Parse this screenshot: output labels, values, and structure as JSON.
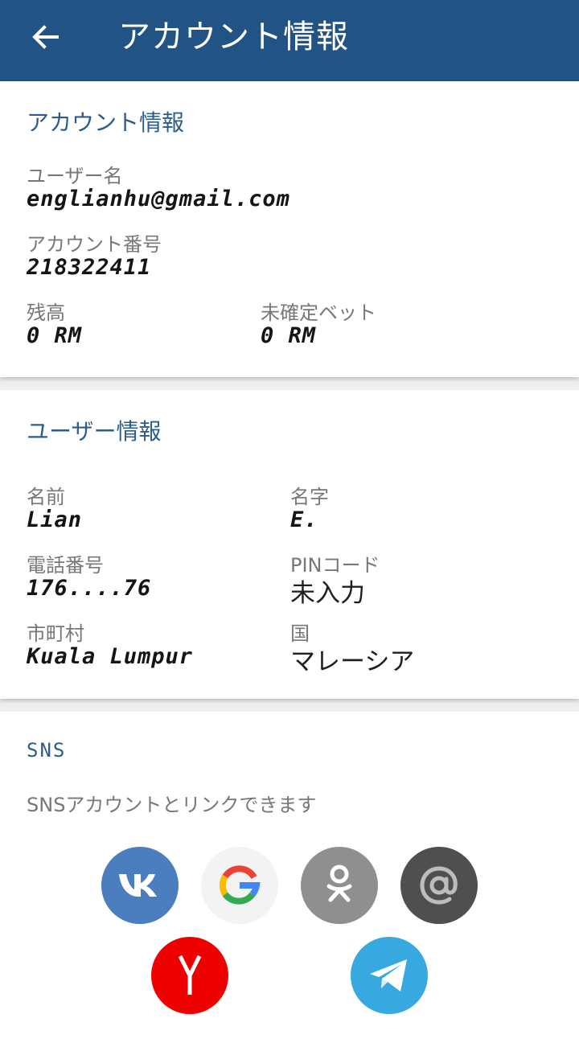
{
  "header": {
    "title": "アカウント情報"
  },
  "account": {
    "section_title": "アカウント情報",
    "username_label": "ユーザー名",
    "username": "englianhu@gmail.com",
    "account_no_label": "アカウント番号",
    "account_no": "218322411",
    "balance_label": "残高",
    "balance": "0 RM",
    "pending_label": "未確定ベット",
    "pending": "0 RM"
  },
  "user": {
    "section_title": "ユーザー情報",
    "first_name_label": "名前",
    "first_name": "Lian",
    "last_name_label": "名字",
    "last_name": "E.",
    "phone_label": "電話番号",
    "phone": "176....76",
    "pin_label": "PINコード",
    "pin": "未入力",
    "city_label": "市町村",
    "city": "Kuala Lumpur",
    "country_label": "国",
    "country": "マレーシア"
  },
  "sns": {
    "section_title": "SNS",
    "description": "SNSアカウントとリンクできます",
    "providers": [
      {
        "icon": "vk-icon",
        "color": "#4a7ebf"
      },
      {
        "icon": "google-icon",
        "color": "#f3f3f3"
      },
      {
        "icon": "odnoklassniki-icon",
        "color": "#8f8f8f"
      },
      {
        "icon": "mail-at-icon",
        "color": "#4f4f4f"
      },
      {
        "icon": "yandex-icon",
        "color": "#ee0000"
      },
      {
        "icon": "telegram-icon",
        "color": "#38a9e0"
      }
    ]
  },
  "colors": {
    "header_bg": "#215384",
    "accent_text": "#2d5d8d"
  }
}
